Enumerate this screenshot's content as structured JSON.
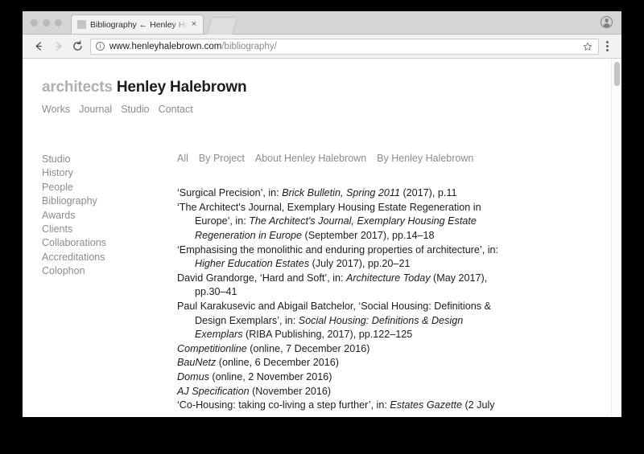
{
  "browser": {
    "window_controls": [
      "close",
      "minimize",
      "maximize"
    ],
    "tab": {
      "title": "Bibliography ← Henley Halebr",
      "favicon_name": "site-favicon",
      "close_label": "×"
    },
    "new_tab_label": "+",
    "toolbar": {
      "back_label": "Back",
      "forward_label": "Forward",
      "reload_label": "Reload",
      "url_domain": "www.henleyhalebrown.com",
      "url_path": "/bibliography/",
      "security_icon": "info-icon",
      "bookmark_icon": "star-icon",
      "menu_icon": "three-dot-menu-icon",
      "profile_icon": "profile-avatar-icon"
    }
  },
  "site": {
    "masthead": {
      "prefix": "architects",
      "name": "Henley Halebrown"
    },
    "nav": [
      {
        "label": "Works"
      },
      {
        "label": "Journal"
      },
      {
        "label": "Studio"
      },
      {
        "label": "Contact"
      }
    ]
  },
  "sidebar": {
    "items": [
      {
        "label": "Studio"
      },
      {
        "label": "History"
      },
      {
        "label": "People"
      },
      {
        "label": "Bibliography"
      },
      {
        "label": "Awards"
      },
      {
        "label": "Clients"
      },
      {
        "label": "Collaborations"
      },
      {
        "label": "Accreditations"
      },
      {
        "label": "Colophon"
      }
    ]
  },
  "content": {
    "filters": [
      {
        "label": "All"
      },
      {
        "label": "By Project"
      },
      {
        "label": "About Henley Halebrown"
      },
      {
        "label": "By Henley Halebrown"
      }
    ],
    "bibliography": [
      {
        "parts": [
          {
            "text": "‘Surgical Precision’, in: ",
            "italic": false
          },
          {
            "text": "Brick Bulletin, Spring 2011",
            "italic": true
          },
          {
            "text": " (2017), p.11",
            "italic": false
          }
        ]
      },
      {
        "parts": [
          {
            "text": "‘The Architect's Journal, Exemplary Housing Estate Regeneration in Europe’, in: ",
            "italic": false
          },
          {
            "text": "The Architect's Journal, Exemplary Housing Estate Regeneration in Europe",
            "italic": true
          },
          {
            "text": " (September 2017), pp.14–18",
            "italic": false
          }
        ]
      },
      {
        "parts": [
          {
            "text": "‘Emphasising the monolithic and enduring properties of architecture’, in: ",
            "italic": false
          },
          {
            "text": "Higher Education Estates",
            "italic": true
          },
          {
            "text": " (July 2017), pp.20–21",
            "italic": false
          }
        ]
      },
      {
        "parts": [
          {
            "text": "David Grandorge, ‘Hard and Soft’, in: ",
            "italic": false
          },
          {
            "text": "Architecture Today",
            "italic": true
          },
          {
            "text": " (May 2017), pp.30–41",
            "italic": false
          }
        ]
      },
      {
        "parts": [
          {
            "text": "Paul Karakusevic and Abigail Batchelor, ‘Social Housing: Definitions & Design Exemplars’, in: ",
            "italic": false
          },
          {
            "text": "Social Housing: Definitions & Design Exemplars",
            "italic": true
          },
          {
            "text": " (RIBA Publishing, 2017), pp.122–125",
            "italic": false
          }
        ]
      },
      {
        "parts": [
          {
            "text": "Competitionline",
            "italic": true
          },
          {
            "text": " (online, 7 December 2016)",
            "italic": false
          }
        ]
      },
      {
        "parts": [
          {
            "text": "BauNetz",
            "italic": true
          },
          {
            "text": " (online, 6 December 2016)",
            "italic": false
          }
        ]
      },
      {
        "parts": [
          {
            "text": "Domus",
            "italic": true
          },
          {
            "text": " (online, 2 November 2016)",
            "italic": false
          }
        ]
      },
      {
        "parts": [
          {
            "text": "AJ Specification",
            "italic": true
          },
          {
            "text": " (November 2016)",
            "italic": false
          }
        ]
      },
      {
        "parts": [
          {
            "text": "‘Co-Housing: taking co-living a step further’, in: ",
            "italic": false
          },
          {
            "text": "Estates Gazette",
            "italic": true
          },
          {
            "text": " (2 July",
            "italic": false
          }
        ]
      }
    ]
  },
  "colors": {
    "page_background": "#ffffff",
    "desktop_background": "#000000",
    "text_primary": "#1c1c1c",
    "text_muted": "#8b8b8b",
    "masthead_prefix": "#b0b0b0",
    "chrome_tabstrip": "#d5d5d5",
    "chrome_toolbar": "#f2f2f2"
  }
}
